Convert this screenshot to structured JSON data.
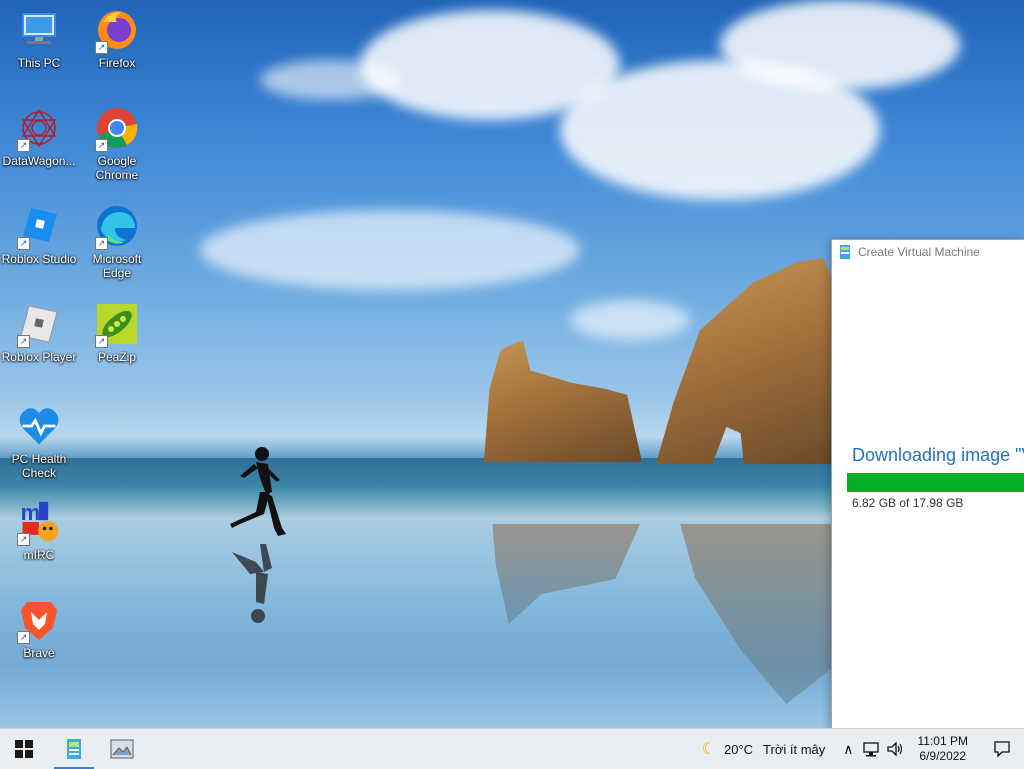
{
  "desktop": {
    "icons": [
      {
        "label": "This PC",
        "icon": "this-pc-icon"
      },
      {
        "label": "Firefox",
        "icon": "firefox-icon"
      },
      {
        "label": "DataWagon...",
        "icon": "datawagon-icon"
      },
      {
        "label": "Google Chrome",
        "icon": "chrome-icon"
      },
      {
        "label": "Roblox Studio",
        "icon": "roblox-studio-icon"
      },
      {
        "label": "Microsoft Edge",
        "icon": "edge-icon"
      },
      {
        "label": "Roblox Player",
        "icon": "roblox-player-icon"
      },
      {
        "label": "PeaZip",
        "icon": "peazip-icon"
      },
      {
        "label": "PC Health Check",
        "icon": "pc-health-check-icon"
      },
      {
        "label": "mIRC",
        "icon": "mirc-icon"
      },
      {
        "label": "Brave",
        "icon": "brave-icon"
      }
    ]
  },
  "window": {
    "title": "Create Virtual Machine",
    "heading": "Downloading image \"V",
    "progress_text": "6.82 GB of 17.98 GB",
    "progress_fraction": 0.379,
    "progress_color": "#06b025"
  },
  "taskbar": {
    "start_icon": "windows-start-icon",
    "apps": [
      "vm-app-icon",
      "image-viewer-icon"
    ],
    "weather_temp": "20°C",
    "weather_text": "Trời ít mây",
    "time": "11:01 PM",
    "date": "6/9/2022"
  }
}
